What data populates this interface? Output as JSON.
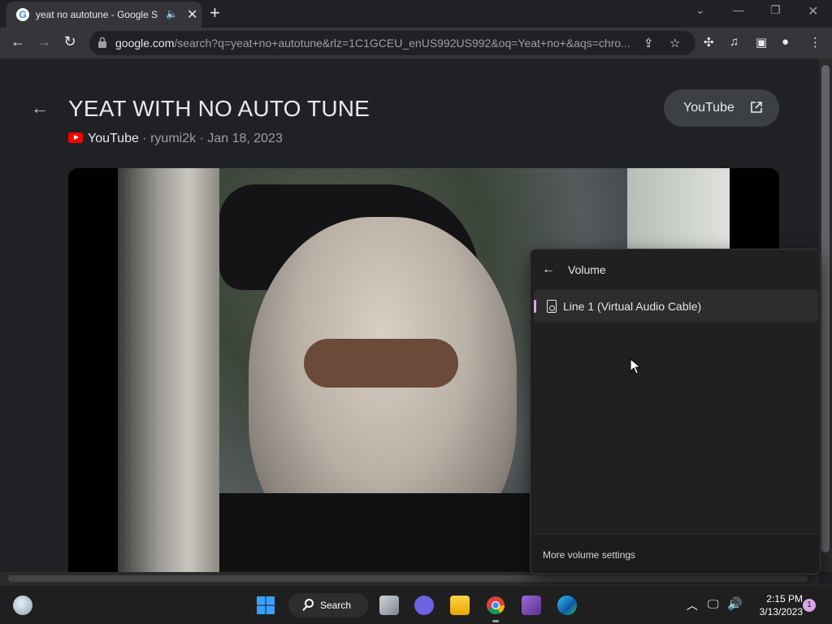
{
  "browser": {
    "tab": {
      "title": "yeat no autotune - Google S",
      "favicon": "G"
    },
    "url_host": "google.com",
    "url_rest": "/search?q=yeat+no+autotune&rlz=1C1GCEU_enUS992US992&oq=Yeat+no+&aqs=chro..."
  },
  "result": {
    "title": "YEAT WITH NO AUTO TUNE",
    "source": "YouTube",
    "meta": " · ryumi2k · Jan 18, 2023",
    "open_button_label": "YouTube"
  },
  "volume_flyout": {
    "title": "Volume",
    "device_name": "Line 1 (Virtual Audio Cable)",
    "more_settings": "More volume settings"
  },
  "taskbar": {
    "search_label": "Search",
    "time": "2:15 PM",
    "date": "3/13/2023",
    "notification_count": "1"
  },
  "colors": {
    "accent": "#d9a5e8",
    "youtube_red": "#ff0000"
  }
}
